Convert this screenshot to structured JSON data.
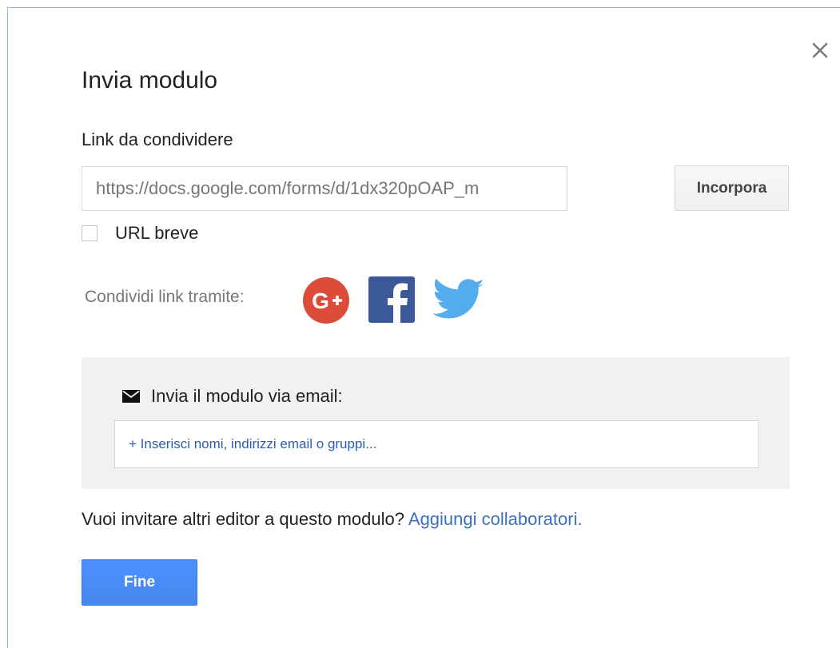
{
  "dialog": {
    "title": "Invia modulo",
    "close_icon": "close-icon"
  },
  "link": {
    "label": "Link da condividere",
    "value": "https://docs.google.com/forms/d/1dx320pOAP_m",
    "embed_label": "Incorpora",
    "short_url_label": "URL breve",
    "short_url_checked": false
  },
  "share": {
    "label": "Condividi link tramite:",
    "services": [
      {
        "name": "Google+",
        "icon": "google-plus-icon",
        "color": "#dd4b39"
      },
      {
        "name": "Facebook",
        "icon": "facebook-icon",
        "color": "#3b5998"
      },
      {
        "name": "Twitter",
        "icon": "twitter-icon",
        "color": "#55acee"
      }
    ]
  },
  "email": {
    "icon": "envelope-icon",
    "label": "Invia il modulo via email:",
    "placeholder": "+ Inserisci nomi, indirizzi email o gruppi..."
  },
  "collaborators": {
    "prompt": "Vuoi invitare altri editor a questo modulo?",
    "link_label": "Aggiungi collaboratori."
  },
  "actions": {
    "done_label": "Fine"
  },
  "colors": {
    "primary_button": "#4d90fe",
    "link": "#3a6fc1",
    "panel_background": "#f1f1f1"
  }
}
